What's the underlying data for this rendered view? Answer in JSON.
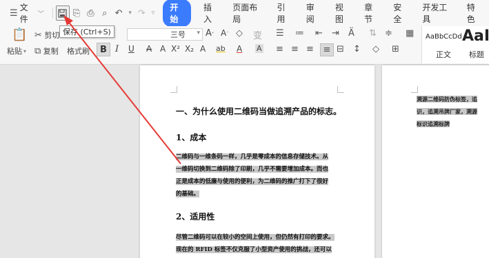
{
  "menubar": {
    "file_label": "文件",
    "tabs": [
      "开始",
      "插入",
      "页面布局",
      "引用",
      "审阅",
      "视图",
      "章节",
      "安全",
      "开发工具",
      "特色"
    ]
  },
  "ribbon": {
    "paste": "粘贴",
    "cut": "剪切",
    "copy": "复制",
    "format_painter": "格式刷",
    "font_size": "三号",
    "styles": {
      "sample_normal": "AaBbCcDd",
      "sample_heading": "AaI",
      "normal": "正文",
      "heading": "标题"
    }
  },
  "tooltip": {
    "text": "保存 (Ctrl+S)"
  },
  "page1": {
    "heading": "一、为什么使用二维码当做追溯产品的标志。",
    "section1_title": "1、成本",
    "section1_lines": [
      "二维码与一维条码一样，几乎是零成本的信息存储技术。从",
      "一维码切换到二维码除了印刷，几乎不需要增加成本。而也",
      "正是成本的低廉与使用的便利，为二维码的推广打下了很好",
      "的基础。"
    ],
    "section2_title": "2、适用性",
    "section2_lines": [
      "尽管二维码可以在较小的空间上使用，但仍然有打印的要求。",
      "现在的 RFID 标签不仅克服了小型资产使用的挑战，还可以"
    ]
  },
  "page2": {
    "lines": [
      "溯源二维码防伪标签，追",
      "识，追溯吊牌厂家，溯源",
      "标识追溯标牌"
    ]
  },
  "colors": {
    "accent": "#3b7cff",
    "arrow": "#e53935",
    "highlight": "#c8c8c8"
  }
}
